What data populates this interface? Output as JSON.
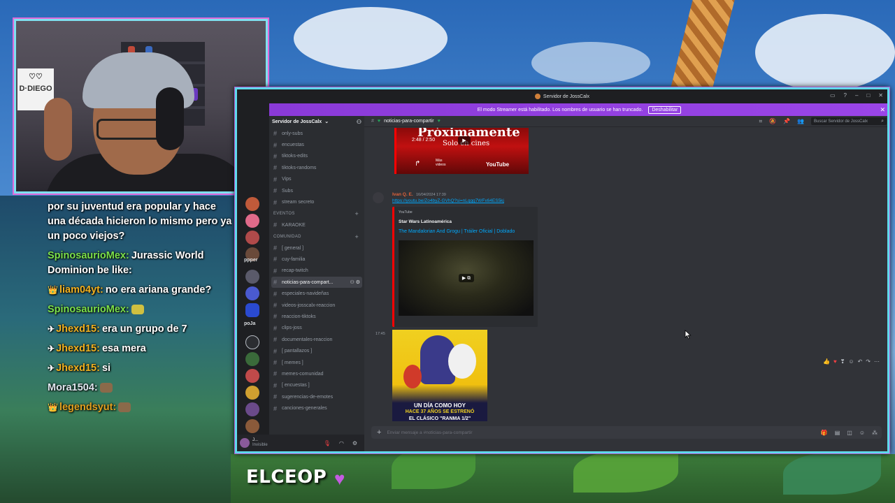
{
  "stream": {
    "streamer_name": "ELCEOP",
    "heart": "♥",
    "webcam_sign": "D·DIEGO"
  },
  "chat": [
    {
      "badge": "",
      "user": "",
      "user_color": "#ffffff",
      "text": "por su juventud era popular y hace una década hicieron lo mismo pero ya un poco viejos?"
    },
    {
      "badge": "",
      "user": "SpinosaurioMex:",
      "user_color": "#7be04a",
      "text": "Jurassic World Dominion be like:"
    },
    {
      "badge": "👑",
      "user": "liam04yt:",
      "user_color": "#f0b020",
      "text": "no era ariana grande?"
    },
    {
      "badge": "",
      "user": "SpinosaurioMex:",
      "user_color": "#7be04a",
      "text": ""
    },
    {
      "badge": "✈",
      "user": "Jhexd15:",
      "user_color": "#f0b020",
      "text": "era un grupo de 7"
    },
    {
      "badge": "✈",
      "user": "Jhexd15:",
      "user_color": "#f0b020",
      "text": "esa mera"
    },
    {
      "badge": "✈",
      "user": "Jhexd15:",
      "user_color": "#f0b020",
      "text": "si"
    },
    {
      "badge": "",
      "user": "Mora1504:",
      "user_color": "#dfe6ee",
      "text": ""
    },
    {
      "badge": "👑",
      "user": "legendsyut:",
      "user_color": "#e0a020",
      "text": ""
    }
  ],
  "discord": {
    "window_title": "Servidor de JossCalx",
    "banner_text": "El modo Streamer está habilitado. Los nombres de usuario se han truncado.",
    "banner_button": "Deshabilitar",
    "server_name": "Servidor de JossCalx",
    "current_channel": "noticias-para-compartir",
    "search_placeholder": "Buscar Servidor de JossCalx",
    "input_placeholder": "Enviar mensaje a #noticias-para-compartir",
    "guild_labels": [
      "ppper",
      "poJa"
    ],
    "channels": [
      {
        "type": "channel",
        "name": "only-subs"
      },
      {
        "type": "channel",
        "name": "encuestas"
      },
      {
        "type": "channel",
        "name": "tiktoks-edits"
      },
      {
        "type": "channel",
        "name": "tiktoks-randoms"
      },
      {
        "type": "channel",
        "name": "Vips"
      },
      {
        "type": "channel",
        "name": "Subs"
      },
      {
        "type": "channel",
        "name": "stream secreto"
      },
      {
        "type": "category",
        "name": "EVENTOS"
      },
      {
        "type": "channel",
        "name": "KARAOKE"
      },
      {
        "type": "category",
        "name": "Comunidad"
      },
      {
        "type": "channel",
        "name": "[ general ]"
      },
      {
        "type": "channel",
        "name": "cuy-familia"
      },
      {
        "type": "channel",
        "name": "recap-twitch"
      },
      {
        "type": "active",
        "name": "noticias-para-compart..."
      },
      {
        "type": "channel",
        "name": "especiales-navideñas"
      },
      {
        "type": "channel",
        "name": "videos-josscalx-reaccion"
      },
      {
        "type": "channel",
        "name": "reaccion-tiktoks"
      },
      {
        "type": "channel",
        "name": "clips-joss"
      },
      {
        "type": "channel",
        "name": "documentales-reaccion"
      },
      {
        "type": "channel",
        "name": "[ pantallazos ]"
      },
      {
        "type": "channel",
        "name": "[ memes ]"
      },
      {
        "type": "channel",
        "name": "memes-comunidad"
      },
      {
        "type": "channel",
        "name": "[ encuestas ]"
      },
      {
        "type": "channel",
        "name": "sugerencias-de-emotes"
      },
      {
        "type": "channel",
        "name": "canciones-generales"
      }
    ],
    "user_panel": {
      "name": "J...",
      "status": "Invisible"
    },
    "messages": {
      "embed1": {
        "video_title_1": "Próximamente",
        "video_title_2": "Solo en cines",
        "time": "2:48 / 2:50",
        "more": "Más videos",
        "youtube": "YouTube"
      },
      "message2": {
        "author": "Ivan Q. E.",
        "timestamp": "16/04/2024 17:39",
        "link": "https://youtu.be/Zo4byZ-GVhQ?si=nLqgg7WFx64ES5kj",
        "provider": "YouTube",
        "channel": "Star Wars Latinoamérica",
        "title": "The Mandalorian And Grogu | Tráiler Oficial | Doblado"
      },
      "message3": {
        "time": "17:45",
        "image_line1": "UN DÍA COMO HOY",
        "image_line2": "HACE 37 AÑOS SE ESTRENÓ",
        "image_line3": "EL CLÁSICO \"RANMA 1/2\""
      }
    }
  }
}
